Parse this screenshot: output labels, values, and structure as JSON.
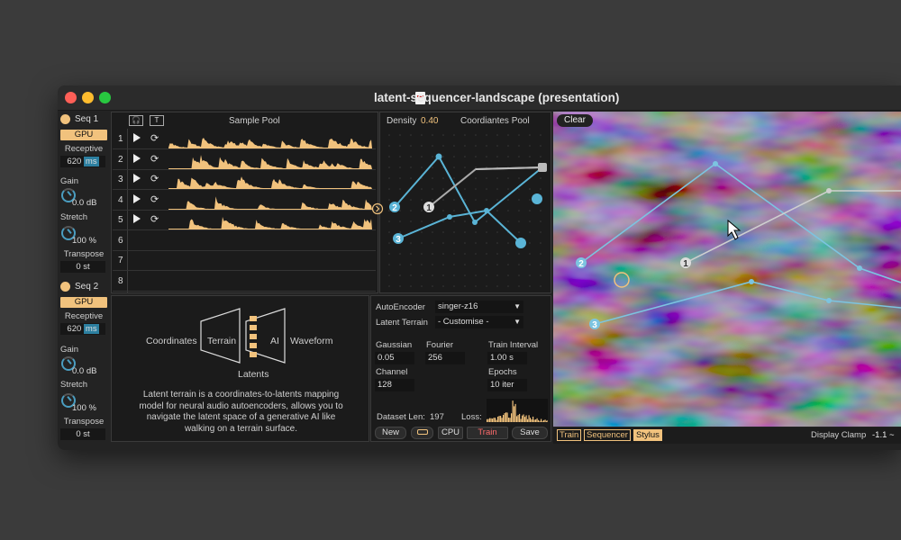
{
  "window": {
    "title": "latent-sequencer-landscape (presentation)"
  },
  "seq1": {
    "title": "Seq 1",
    "gpu": "GPU",
    "receptive_label": "Receptive",
    "receptive_value": "620",
    "receptive_unit": "ms",
    "gain_label": "Gain",
    "gain_value": "0.0 dB",
    "stretch_label": "Stretch",
    "stretch_value": "100 %",
    "transpose_label": "Transpose",
    "transpose_value": "0 st"
  },
  "seq2": {
    "title": "Seq 2",
    "gpu": "GPU",
    "receptive_label": "Receptive",
    "receptive_value": "620",
    "receptive_unit": "ms",
    "gain_label": "Gain",
    "gain_value": "0.0 dB",
    "stretch_label": "Stretch",
    "stretch_value": "100 %",
    "transpose_label": "Transpose",
    "transpose_value": "0 st"
  },
  "sample_pool": {
    "title": "Sample Pool",
    "headphone_btn": "🎧",
    "t_btn": "T",
    "rows": [
      "1",
      "2",
      "3",
      "4",
      "5",
      "6",
      "7",
      "8"
    ]
  },
  "coord_pool": {
    "density_label": "Density",
    "density_value": "0.40",
    "title": "Coordiantes Pool",
    "points": [
      "1",
      "2",
      "3"
    ]
  },
  "diagram": {
    "coordinates": "Coordinates",
    "terrain": "Terrain",
    "ai": "AI",
    "waveform": "Waveform",
    "latents": "Latents",
    "description": "Latent terrain is a coordinates-to-latents mapping model for neural audio autoencoders, allows you to navigate the latent space of a generative AI like walking on a terrain surface."
  },
  "settings": {
    "autoencoder_label": "AutoEncoder",
    "autoencoder_value": "singer-z16",
    "latent_terrain_label": "Latent Terrain",
    "latent_terrain_value": "- Customise -",
    "gaussian_label": "Gaussian",
    "gaussian_value": "0.05",
    "fourier_label": "Fourier",
    "fourier_value": "256",
    "train_interval_label": "Train Interval",
    "train_interval_value": "1.00 s",
    "channel_label": "Channel",
    "channel_value": "128",
    "epochs_label": "Epochs",
    "epochs_value": "10 iter",
    "dataset_len_label": "Dataset Len:",
    "dataset_len_value": "197",
    "loss_label": "Loss:",
    "btn_new": "New",
    "btn_cpu": "CPU",
    "btn_train": "Train",
    "btn_save": "Save"
  },
  "terrain": {
    "clear": "Clear",
    "points": [
      "1",
      "2",
      "3"
    ],
    "tab_train": "Train",
    "tab_sequencer": "Sequencer",
    "tab_stylus": "Stylus",
    "display_clamp_label": "Display Clamp",
    "display_clamp_value": "-1.1 ~"
  },
  "colors": {
    "accent": "#f1c27d",
    "line": "#5ab4d6",
    "train_red": "#ff6b6b"
  }
}
